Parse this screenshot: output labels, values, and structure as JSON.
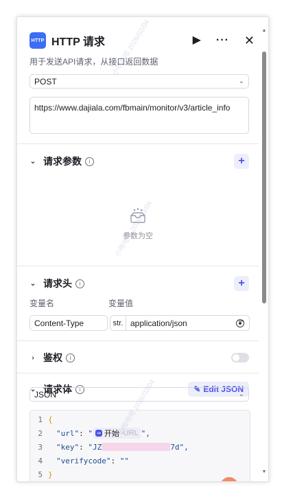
{
  "node": {
    "icon_text": "HTTP",
    "title": "HTTP 请求",
    "description": "用于发送API请求，从接口返回数据",
    "header_icons": {
      "run": "play-icon",
      "more": "more-icon",
      "close": "close-icon"
    }
  },
  "request": {
    "method": "POST",
    "url": "https://www.dajiala.com/fbmain/monitor/v3/article_info"
  },
  "params": {
    "title": "请求参数",
    "empty_text": "参数为空"
  },
  "headers": {
    "title": "请求头",
    "col_name": "变量名",
    "col_value": "变量值",
    "rows": [
      {
        "name": "Content-Type",
        "type": "str.",
        "value": "application/json"
      }
    ]
  },
  "auth": {
    "title": "鉴权",
    "enabled": false
  },
  "body": {
    "title": "请求体",
    "edit_json_label": "Edit JSON",
    "type": "JSON",
    "code": {
      "line_numbers": [
        "1",
        "2",
        "3",
        "4",
        "5"
      ],
      "open": "{",
      "url_key": "\"url\"",
      "colon": ": ",
      "quote": "\"",
      "url_chip": "开始",
      "url_chip_sub": "-URL",
      "quote_comma": "\",",
      "key_key": "\"key\"",
      "key_prefix": "\"JZ",
      "key_suffix": "7d\",",
      "verify_key": "\"verifycode\"",
      "verify_value": "\"\"",
      "close": "}"
    }
  },
  "watermark": "小哈哈哈 2026/02/04",
  "colors": {
    "accent": "#4d53e8",
    "brand": "#3b6df5"
  }
}
